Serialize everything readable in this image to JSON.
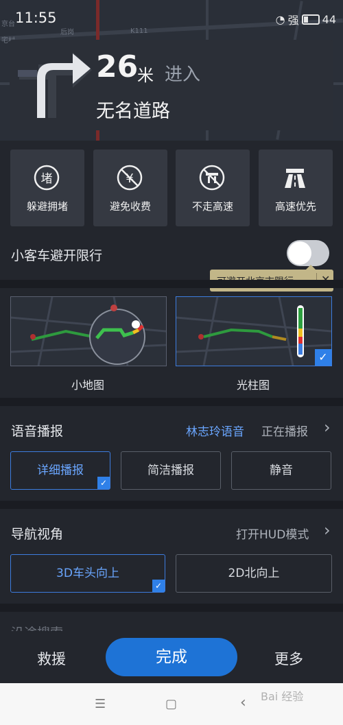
{
  "status": {
    "time": "11:55",
    "signal": "强",
    "battery": "44"
  },
  "map": {
    "labels": [
      "宅村",
      "后岗",
      "K111",
      "京台"
    ]
  },
  "nav": {
    "distance_num": "26",
    "distance_unit": "米",
    "action": "进入",
    "road": "无名道路",
    "turn_icon": "turn-right-icon"
  },
  "prefs": [
    {
      "icon": "堵",
      "label": "躲避拥堵"
    },
    {
      "icon": "¥",
      "label": "避免收费"
    },
    {
      "icon": "高速禁",
      "label": "不走高速"
    },
    {
      "icon": "高速",
      "label": "高速优先"
    }
  ],
  "restriction": {
    "label": "小客车避开限行",
    "enabled": false,
    "tip": "可避开北京市限行",
    "tip_close": "✕"
  },
  "map_modes": [
    {
      "caption": "小地图",
      "selected": false
    },
    {
      "caption": "光柱图",
      "selected": true
    }
  ],
  "voice": {
    "title": "语音播报",
    "voice_name": "林志玲语音",
    "voice_status": "正在播报",
    "chevron": "›",
    "options": [
      {
        "label": "详细播报",
        "selected": true
      },
      {
        "label": "简洁播报",
        "selected": false
      },
      {
        "label": "静音",
        "selected": false
      }
    ]
  },
  "view": {
    "title": "导航视角",
    "hud_label": "打开HUD模式",
    "chevron": "›",
    "options": [
      {
        "label": "3D车头向上",
        "selected": true
      },
      {
        "label": "2D北向上",
        "selected": false
      }
    ]
  },
  "next_section_partial": "沿途搜索",
  "bottom": {
    "rescue": "救援",
    "done": "完成",
    "more": "更多"
  },
  "sysnav": {
    "menu": "☰",
    "home": "▢",
    "back": "‹"
  },
  "watermark": "Bai 经验",
  "colors": {
    "accent": "#1e73d6",
    "tip_bg": "#c2b688",
    "panel": "#23262d"
  }
}
